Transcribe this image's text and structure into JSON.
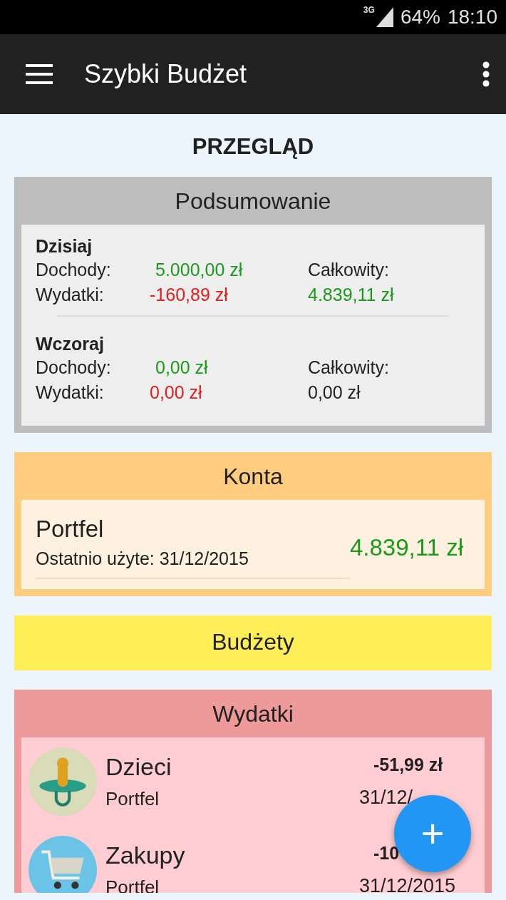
{
  "status_bar": {
    "network": "3G",
    "battery": "64%",
    "time": "18:10"
  },
  "app_bar": {
    "title": "Szybki Budżet"
  },
  "page_title": "PRZEGLĄD",
  "summary": {
    "title": "Podsumowanie",
    "periods": [
      {
        "name": "Dzisiaj",
        "income_label": "Dochody:",
        "income": "5.000,00 zł",
        "expense_label": "Wydatki:",
        "expense": "-160,89 zł",
        "total_label": "Całkowity:",
        "total": {
          "text": "4.839,11 zł",
          "color": "#1a9a1a"
        }
      },
      {
        "name": "Wczoraj",
        "income_label": "Dochody:",
        "income": "0,00 zł",
        "expense_label": "Wydatki:",
        "expense": "0,00 zł",
        "total_label": "Całkowity:",
        "total": {
          "text": "0,00 zł",
          "color": "#222222"
        }
      }
    ]
  },
  "accounts": {
    "title": "Konta",
    "items": [
      {
        "name": "Portfel",
        "last_used": "Ostatnio użyte: 31/12/2015",
        "balance": "4.839,11 zł"
      }
    ]
  },
  "budgets": {
    "title": "Budżety"
  },
  "expenses": {
    "title": "Wydatki",
    "items": [
      {
        "kind": "pacifier",
        "category": "Dzieci",
        "account": "Portfel",
        "amount": "-51,99 zł",
        "date": "31/12/"
      },
      {
        "kind": "cart",
        "category": "Zakupy",
        "account": "Portfel",
        "amount": "-10",
        "date": "31/12/2015"
      }
    ]
  },
  "fab": {
    "label": "+"
  }
}
